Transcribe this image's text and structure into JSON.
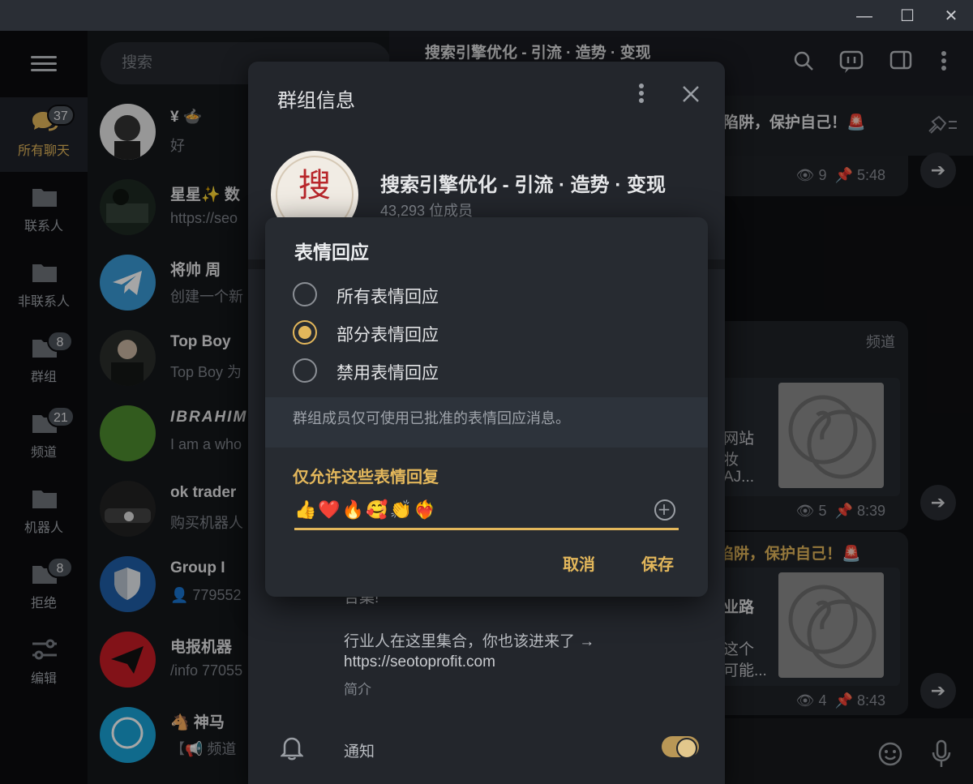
{
  "window": {
    "minimize": "—",
    "maximize": "☐",
    "close": "✕"
  },
  "folders": [
    {
      "label": "所有聊天",
      "badge": "37",
      "active": true
    },
    {
      "label": "联系人",
      "badge": ""
    },
    {
      "label": "非联系人",
      "badge": ""
    },
    {
      "label": "群组",
      "badge": "8"
    },
    {
      "label": "频道",
      "badge": "21"
    },
    {
      "label": "机器人",
      "badge": ""
    },
    {
      "label": "拒绝",
      "badge": "8"
    },
    {
      "label": "编辑",
      "badge": ""
    }
  ],
  "search": {
    "placeholder": "搜索"
  },
  "chats": [
    {
      "title": "¥ 🍲",
      "subtitle": "好"
    },
    {
      "title": "星星✨ 数",
      "subtitle": "https://seo"
    },
    {
      "title": "将帅 周",
      "subtitle": "创建一个新"
    },
    {
      "title": "Top Boy",
      "subtitle": "Top Boy 为"
    },
    {
      "title": "IBRAHIM",
      "subtitle": "I am a who"
    },
    {
      "title": "ok trader",
      "subtitle": "购买机器人"
    },
    {
      "title": "Group I",
      "subtitle": "👤 779552"
    },
    {
      "title": "电报机器",
      "subtitle": "/info 77055"
    },
    {
      "title": "🐴 神马",
      "subtitle": "【📢 频道"
    }
  ],
  "conversation": {
    "title": "搜索引擎优化 - 引流 · 造势 · 变现",
    "pinned_text": "陷阱，保护自己！🚨",
    "messages": [
      {
        "views": "9",
        "time": "5:48"
      },
      {
        "channel_label": "频道",
        "snippet_1": "网站",
        "snippet_2": "妆",
        "snippet_3": "AJ...",
        "views": "5",
        "time": "8:39"
      },
      {
        "headline": "陷阱，保护自己！🚨",
        "snippet_1": "业路",
        "snippet_2": "这个",
        "snippet_3": "可能...",
        "views": "4",
        "time": "8:43"
      }
    ]
  },
  "group_info": {
    "title": "群组信息",
    "name": "搜索引擎优化 - 引流 · 造势 · 变现",
    "members": "43,293 位成员",
    "avatar_char": "搜",
    "desc_fragment": "合集!",
    "desc_line": "行业人在这里集合，你也该进来了 →",
    "link": "https://seotoprofit.com",
    "desc_label": "简介",
    "notifications_label": "通知",
    "notifications_on": true
  },
  "reactions_dialog": {
    "title": "表情回应",
    "options": [
      {
        "label": "所有表情回应",
        "selected": false
      },
      {
        "label": "部分表情回应",
        "selected": true
      },
      {
        "label": "禁用表情回应",
        "selected": false
      }
    ],
    "note": "群组成员仅可使用已批准的表情回应消息。",
    "allowed_label": "仅允许这些表情回复",
    "allowed_emojis": "👍❤️🔥🥰👏❤️‍🔥",
    "cancel": "取消",
    "save": "保存"
  },
  "colors": {
    "accent": "#e3b75b",
    "panel": "#23262c",
    "dialog": "#272b31"
  }
}
